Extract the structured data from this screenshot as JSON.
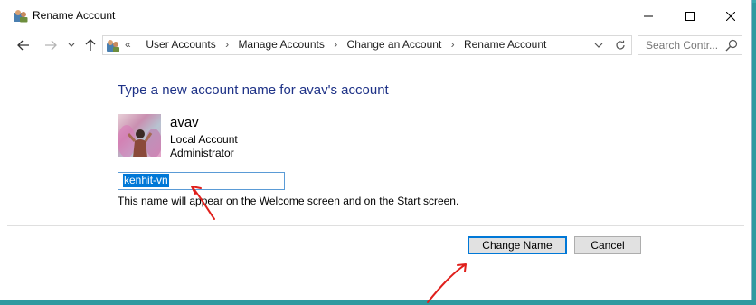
{
  "window": {
    "title": "Rename Account",
    "title_icon": "user-accounts-icon",
    "controls": [
      "minimize-icon",
      "maximize-icon",
      "close-icon"
    ]
  },
  "navigation": {
    "back_icon": "arrow-left-icon",
    "forward_icon": "arrow-right-icon",
    "recent_icon": "chevron-down-icon",
    "up_icon": "arrow-up-icon",
    "address": {
      "icon": "control-panel-icon",
      "overflow": "«",
      "crumbs": [
        "User Accounts",
        "Manage Accounts",
        "Change an Account",
        "Rename Account"
      ],
      "separator": "›",
      "dropdown_icon": "chevron-down-icon",
      "refresh_icon": "refresh-icon"
    },
    "search": {
      "placeholder": "Search Contr...",
      "icon": "search-icon"
    }
  },
  "main": {
    "heading": "Type a new account name for avav's account",
    "account": {
      "name": "avav",
      "type": "Local Account",
      "role": "Administrator"
    },
    "name_field": {
      "value": "kenhit-vn",
      "selected": true
    },
    "hint": "This name will appear on the Welcome screen and on the Start screen."
  },
  "footer": {
    "change_name_label": "Change Name",
    "cancel_label": "Cancel"
  },
  "colors": {
    "heading": "#1e3287",
    "selection": "#0078d7",
    "annotation": "#e0201c",
    "desktop": "#2f9aa0"
  }
}
